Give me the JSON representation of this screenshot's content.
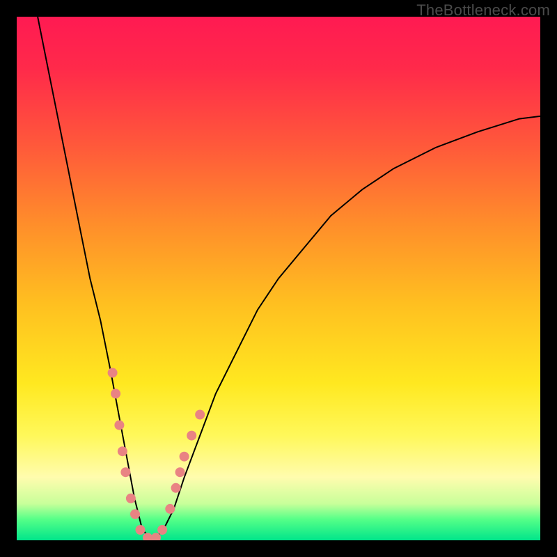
{
  "watermark": "TheBottleneck.com",
  "chart_data": {
    "type": "line",
    "title": "",
    "xlabel": "",
    "ylabel": "",
    "xlim": [
      0,
      100
    ],
    "ylim": [
      0,
      100
    ],
    "gradient_description": "vertical red-to-green background (red high bottleneck, green low)",
    "series": [
      {
        "name": "bottleneck-curve",
        "x": [
          4,
          6,
          8,
          10,
          12,
          14,
          16,
          18,
          19.5,
          21,
          22.5,
          24,
          26,
          28,
          30,
          32,
          35,
          38,
          42,
          46,
          50,
          55,
          60,
          66,
          72,
          80,
          88,
          96,
          100
        ],
        "y": [
          100,
          90,
          80,
          70,
          60,
          50,
          42,
          32,
          24,
          16,
          8,
          2,
          0,
          2,
          6,
          12,
          20,
          28,
          36,
          44,
          50,
          56,
          62,
          67,
          71,
          75,
          78,
          80.5,
          81
        ]
      }
    ],
    "markers": [
      {
        "x": 18.3,
        "y": 32
      },
      {
        "x": 18.9,
        "y": 28
      },
      {
        "x": 19.6,
        "y": 22
      },
      {
        "x": 20.2,
        "y": 17
      },
      {
        "x": 20.8,
        "y": 13
      },
      {
        "x": 21.8,
        "y": 8
      },
      {
        "x": 22.6,
        "y": 5
      },
      {
        "x": 23.6,
        "y": 2
      },
      {
        "x": 25.0,
        "y": 0.5
      },
      {
        "x": 26.6,
        "y": 0.5
      },
      {
        "x": 27.8,
        "y": 2
      },
      {
        "x": 29.3,
        "y": 6
      },
      {
        "x": 30.4,
        "y": 10
      },
      {
        "x": 31.2,
        "y": 13
      },
      {
        "x": 32.0,
        "y": 16
      },
      {
        "x": 33.4,
        "y": 20
      },
      {
        "x": 35.0,
        "y": 24
      }
    ],
    "marker_radius_px": 7
  }
}
